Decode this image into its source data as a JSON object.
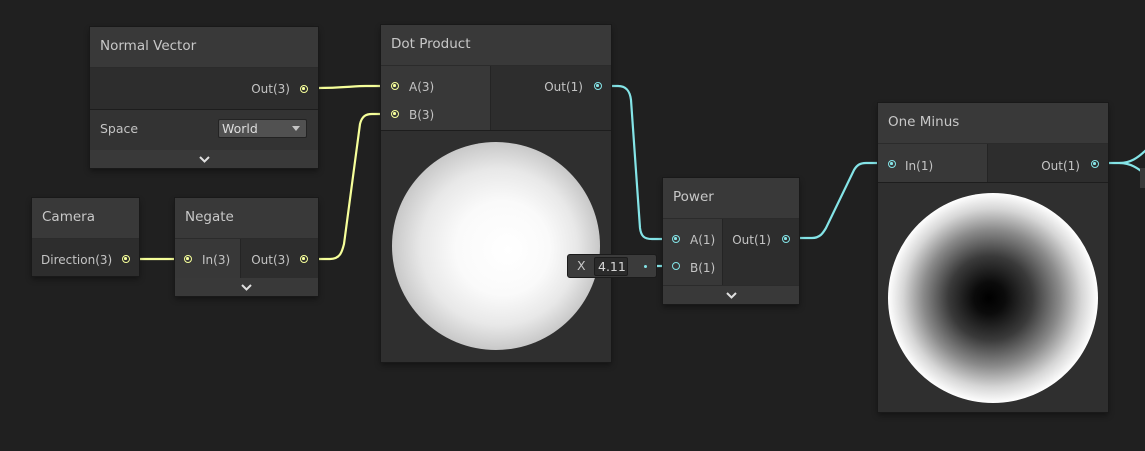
{
  "graph": {
    "wire_colors": {
      "vector3": "#f6ff9a",
      "vector1": "#84e4e7"
    },
    "nodes": {
      "normal_vector": {
        "title": "Normal Vector",
        "output_label": "Out(3)",
        "space_label": "Space",
        "space_value": "World"
      },
      "camera": {
        "title": "Camera",
        "output_label": "Direction(3)"
      },
      "negate": {
        "title": "Negate",
        "input_label": "In(3)",
        "output_label": "Out(3)"
      },
      "dot_product": {
        "title": "Dot Product",
        "input_a_label": "A(3)",
        "input_b_label": "B(3)",
        "output_label": "Out(1)"
      },
      "power": {
        "title": "Power",
        "input_a_label": "A(1)",
        "input_b_label": "B(1)",
        "output_label": "Out(1)",
        "b_input": {
          "axis": "X",
          "value": "4.11"
        }
      },
      "one_minus": {
        "title": "One Minus",
        "input_label": "In(1)",
        "output_label": "Out(1)"
      }
    }
  }
}
